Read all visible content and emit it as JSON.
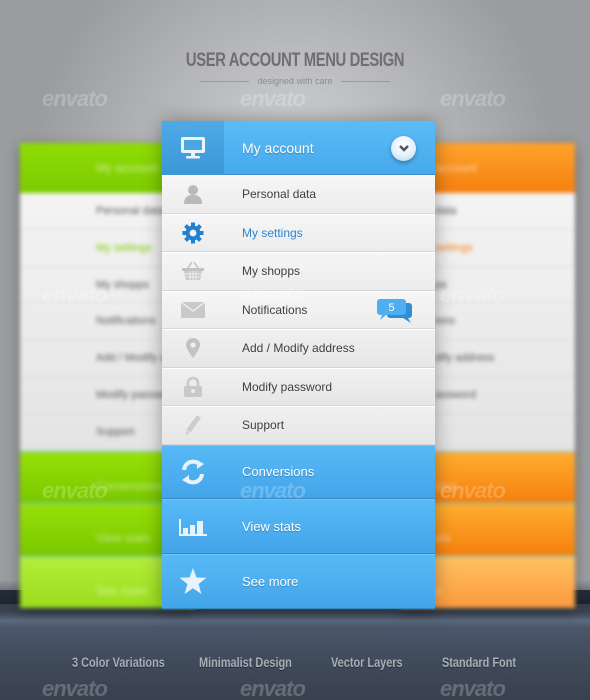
{
  "header": {
    "title": "USER ACCOUNT MENU DESIGN",
    "subtitle": "designed with care"
  },
  "watermark": "envato",
  "menu": {
    "title": "My account",
    "title_icon": "monitor-icon",
    "toggle_icon": "chevron-down-icon",
    "accent": "#4aaeee",
    "items": [
      {
        "label": "Personal data",
        "icon": "user-icon",
        "active": false
      },
      {
        "label": "My settings",
        "icon": "gear-icon",
        "active": true
      },
      {
        "label": "My shopps",
        "icon": "basket-icon",
        "active": false
      },
      {
        "label": "Notifications",
        "icon": "envelope-icon",
        "active": false,
        "badge": "5"
      },
      {
        "label": "Add / Modify address",
        "icon": "map-pin-icon",
        "active": false
      },
      {
        "label": "Modify password",
        "icon": "lock-icon",
        "active": false
      },
      {
        "label": "Support",
        "icon": "pencil-icon",
        "active": false
      }
    ],
    "actions": [
      {
        "label": "Conversions",
        "icon": "refresh-icon"
      },
      {
        "label": "View stats",
        "icon": "bar-chart-icon"
      },
      {
        "label": "See more",
        "icon": "star-icon"
      }
    ]
  },
  "variants": {
    "left": {
      "color": "#7ccb00",
      "title": "My account",
      "items": [
        "Personal data",
        "My settings",
        "My shopps",
        "Notifications",
        "Add / Modify address",
        "Modify password",
        "Support"
      ],
      "actions": [
        "Conversions",
        "View stats",
        "See more"
      ]
    },
    "right": {
      "color": "#f57f10",
      "title": "account",
      "items": [
        "data",
        "settings",
        "ps",
        "ions",
        "dify address",
        "assword",
        ""
      ],
      "actions": [
        "ions",
        "ats",
        "e"
      ]
    }
  },
  "features": [
    "3 Color Variations",
    "Minimalist Design",
    "Vector Layers",
    "Standard Font"
  ]
}
